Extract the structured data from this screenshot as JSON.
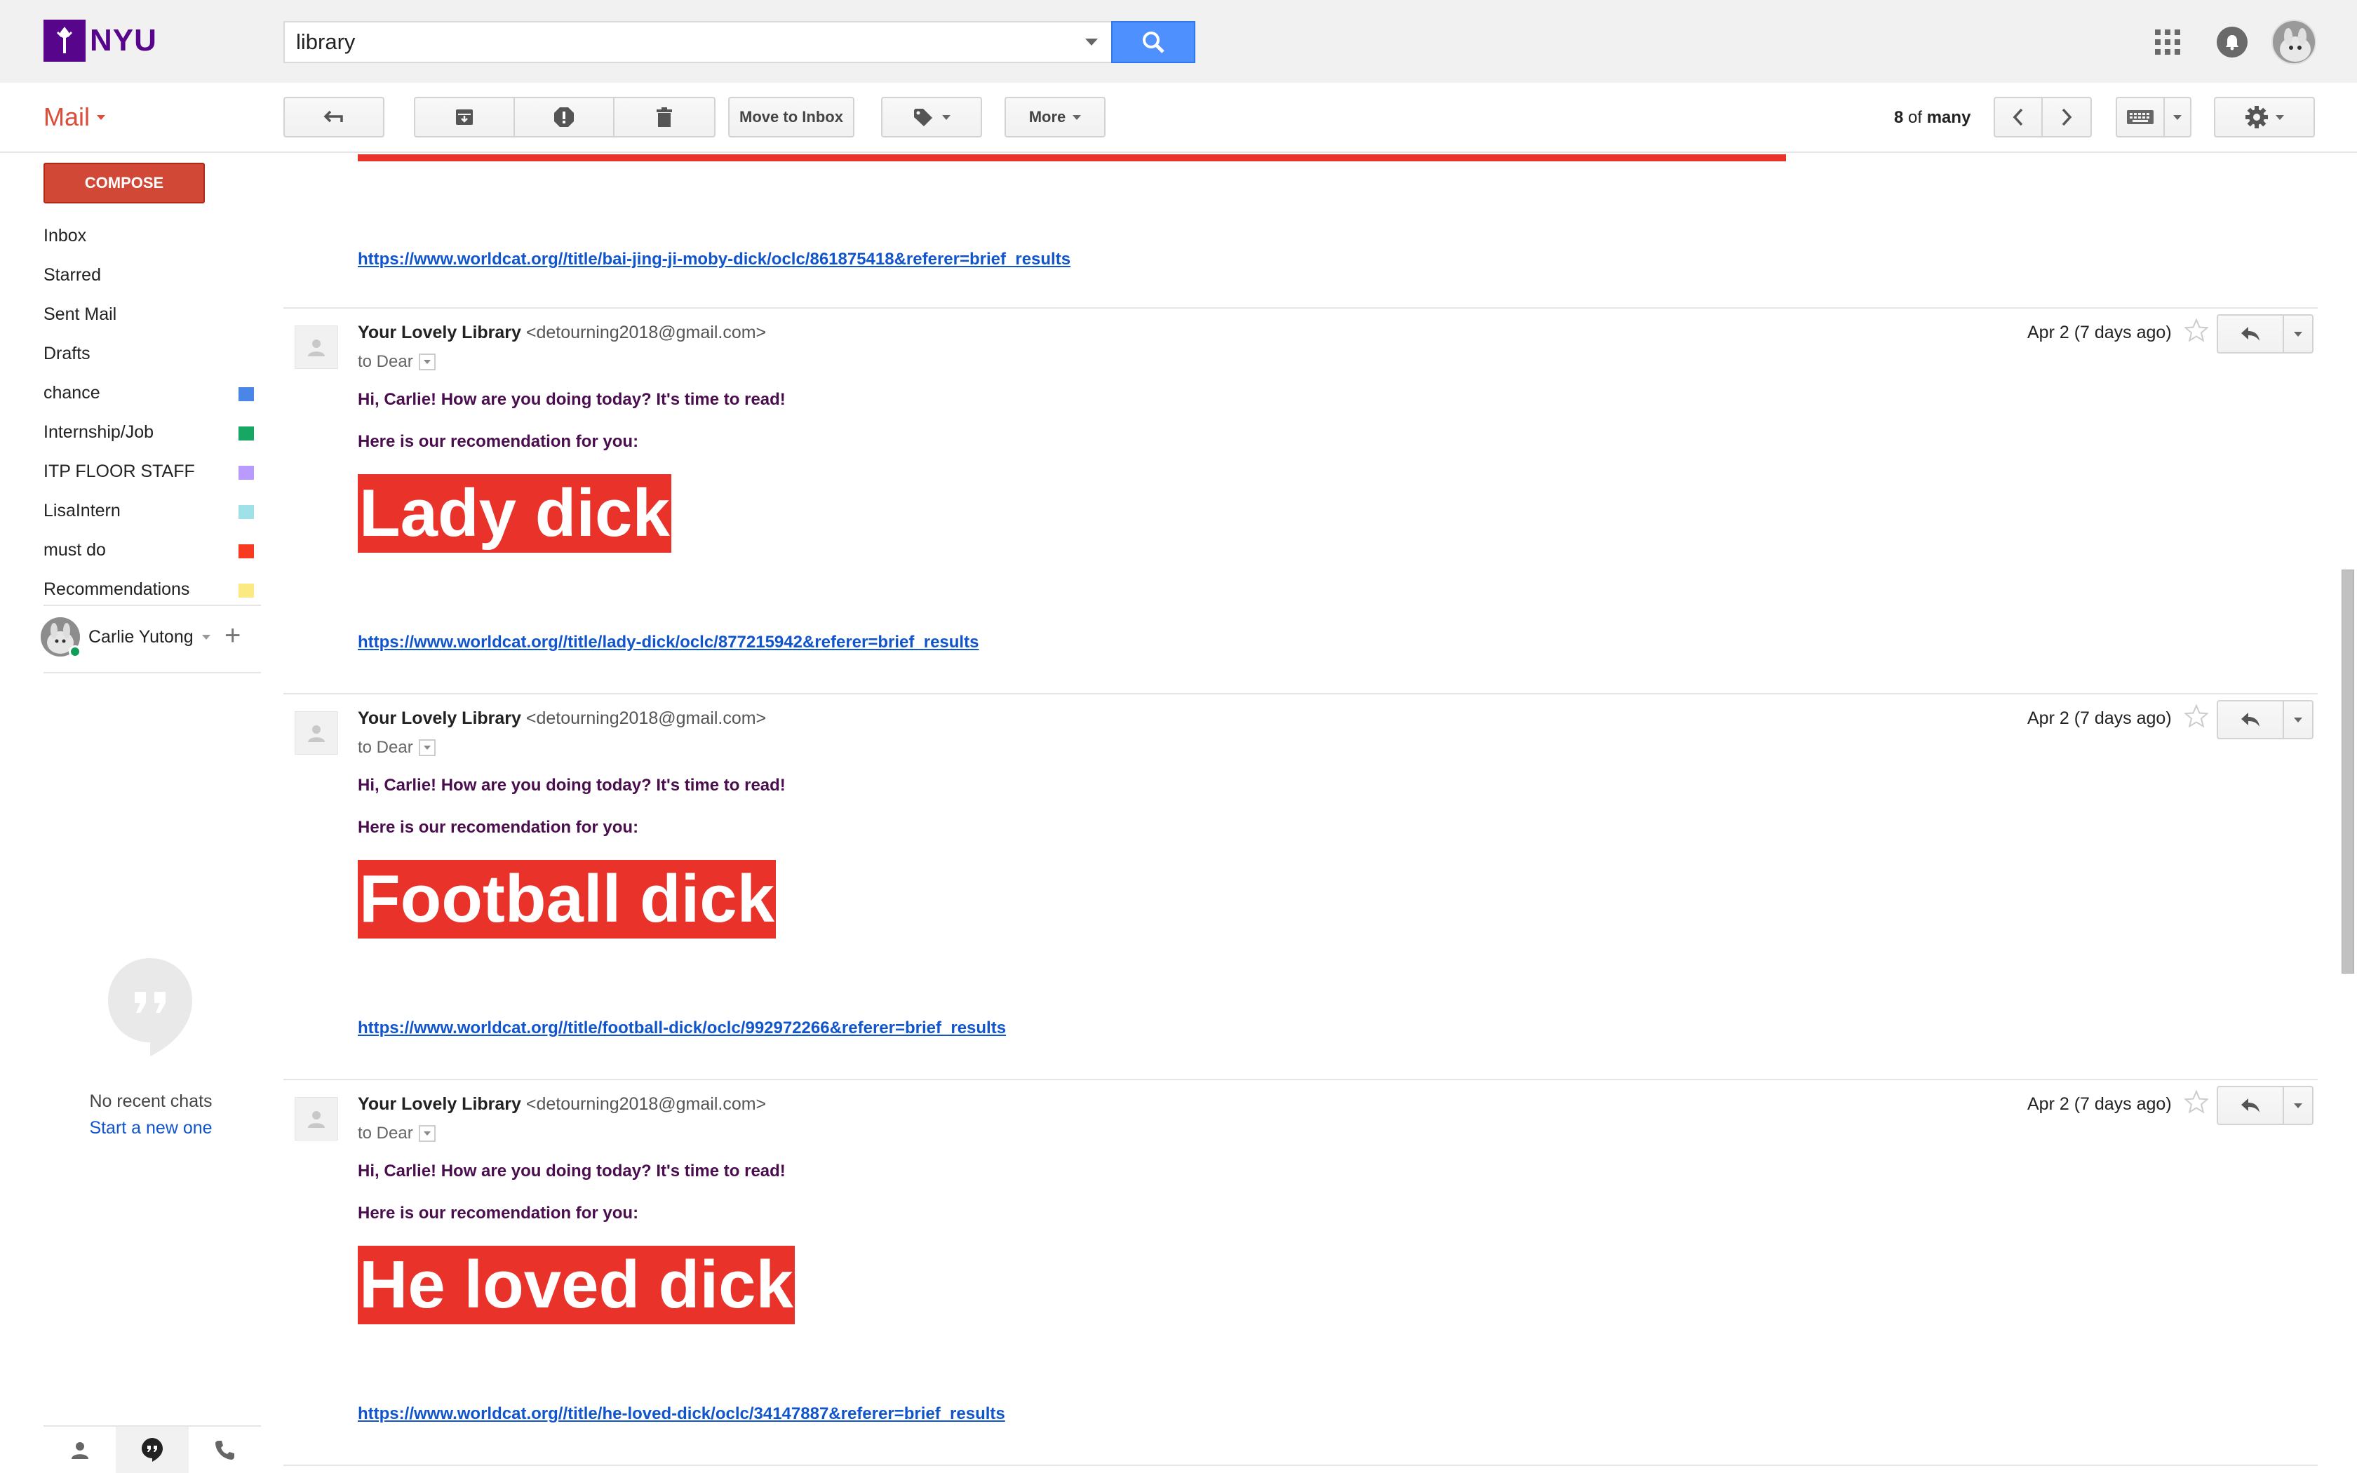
{
  "brand": {
    "logo_text": "NYU"
  },
  "search": {
    "value": "library"
  },
  "toolbar": {
    "mail_label": "Mail",
    "move_to_inbox": "Move to Inbox",
    "more": "More",
    "counter_current": "8",
    "counter_of": "of",
    "counter_total": "many"
  },
  "sidebar": {
    "compose": "COMPOSE",
    "items": [
      {
        "label": "Inbox",
        "color": ""
      },
      {
        "label": "Starred",
        "color": ""
      },
      {
        "label": "Sent Mail",
        "color": ""
      },
      {
        "label": "Drafts",
        "color": ""
      },
      {
        "label": "chance",
        "color": "#4986e7"
      },
      {
        "label": "Internship/Job",
        "color": "#16a765"
      },
      {
        "label": "ITP FLOOR STAFF",
        "color": "#b99aff"
      },
      {
        "label": "LisaIntern",
        "color": "#9fe1e7"
      },
      {
        "label": "must do",
        "color": "#f83a22"
      },
      {
        "label": "Recommendations",
        "color": "#fbe983"
      }
    ],
    "account_name": "Carlie Yutong",
    "no_chats": "No recent chats",
    "start_chat": "Start a new one"
  },
  "thread": {
    "prev_link": "https://www.worldcat.org//title/bai-jing-ji-moby-dick/oclc/861875418&referer=brief_results",
    "messages": [
      {
        "sender": "Your Lovely Library",
        "email": "<detourning2018@gmail.com>",
        "to": "to Dear",
        "date": "Apr 2 (7 days ago)",
        "greeting": "Hi, Carlie! How are you doing today? It's time to read!",
        "recommend": "Here is our recomendation for you:",
        "book": "Lady dick",
        "link": "https://www.worldcat.org//title/lady-dick/oclc/877215942&referer=brief_results"
      },
      {
        "sender": "Your Lovely Library",
        "email": "<detourning2018@gmail.com>",
        "to": "to Dear",
        "date": "Apr 2 (7 days ago)",
        "greeting": "Hi, Carlie! How are you doing today? It's time to read!",
        "recommend": "Here is our recomendation for you:",
        "book": "Football dick",
        "link": "https://www.worldcat.org//title/football-dick/oclc/992972266&referer=brief_results"
      },
      {
        "sender": "Your Lovely Library",
        "email": "<detourning2018@gmail.com>",
        "to": "to Dear",
        "date": "Apr 2 (7 days ago)",
        "greeting": "Hi, Carlie! How are you doing today? It's time to read!",
        "recommend": "Here is our recomendation for you:",
        "book": "He loved dick",
        "link": "https://www.worldcat.org//title/he-loved-dick/oclc/34147887&referer=brief_results"
      }
    ]
  },
  "colors": {
    "accent_red": "#dd4b39",
    "compose_red": "#d14836",
    "banner_red": "#e8322a",
    "link_blue": "#1155cc",
    "search_blue": "#4d90fe",
    "nyu_purple": "#57068c"
  },
  "icons": [
    "nyu-torch-icon",
    "dropdown-caret-icon",
    "search-icon",
    "apps-grid-icon",
    "notifications-icon",
    "back-arrow-icon",
    "archive-icon",
    "spam-icon",
    "trash-icon",
    "label-icon",
    "chevron-left-icon",
    "chevron-right-icon",
    "keyboard-icon",
    "gear-icon",
    "star-icon",
    "reply-icon",
    "person-icon",
    "hangouts-icon",
    "phone-icon",
    "plus-icon"
  ]
}
